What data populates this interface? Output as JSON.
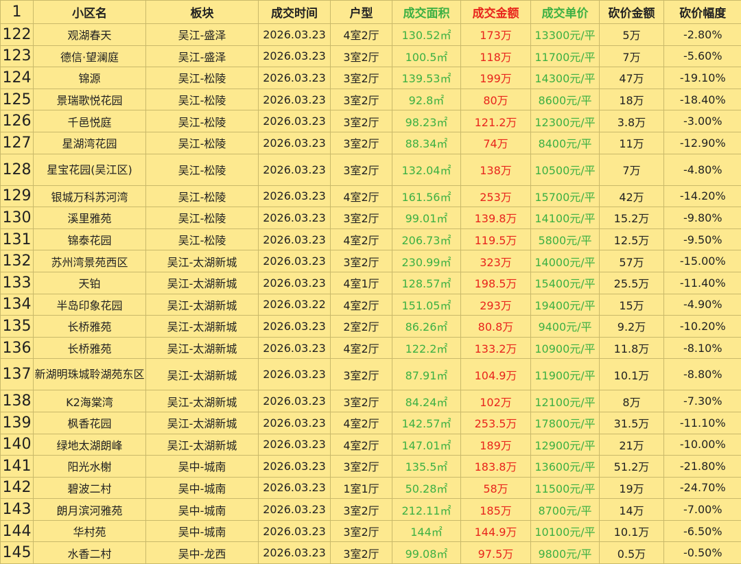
{
  "headers": [
    {
      "text": "1",
      "color": ""
    },
    {
      "text": "小区名",
      "color": ""
    },
    {
      "text": "板块",
      "color": ""
    },
    {
      "text": "成交时间",
      "color": ""
    },
    {
      "text": "户型",
      "color": ""
    },
    {
      "text": "成交面积",
      "color": "green"
    },
    {
      "text": "成交金额",
      "color": "red"
    },
    {
      "text": "成交单价",
      "color": "green"
    },
    {
      "text": "砍价金额",
      "color": ""
    },
    {
      "text": "砍价幅度",
      "color": ""
    }
  ],
  "rows": [
    [
      "122",
      "观湖春天",
      "吴江-盛泽",
      "2026.03.23",
      "4室2厅",
      "130.52㎡",
      "173万",
      "13300元/平",
      "5万",
      "-2.80%"
    ],
    [
      "123",
      "德信·望澜庭",
      "吴江-盛泽",
      "2026.03.23",
      "3室2厅",
      "100.5㎡",
      "118万",
      "11700元/平",
      "7万",
      "-5.60%"
    ],
    [
      "124",
      "锦源",
      "吴江-松陵",
      "2026.03.23",
      "3室2厅",
      "139.53㎡",
      "199万",
      "14300元/平",
      "47万",
      "-19.10%"
    ],
    [
      "125",
      "景瑞歌悦花园",
      "吴江-松陵",
      "2026.03.23",
      "3室2厅",
      "92.8㎡",
      "80万",
      "8600元/平",
      "18万",
      "-18.40%"
    ],
    [
      "126",
      "千邑悦庭",
      "吴江-松陵",
      "2026.03.23",
      "3室2厅",
      "98.23㎡",
      "121.2万",
      "12300元/平",
      "3.8万",
      "-3.00%"
    ],
    [
      "127",
      "星湖湾花园",
      "吴江-松陵",
      "2026.03.23",
      "3室2厅",
      "88.34㎡",
      "74万",
      "8400元/平",
      "11万",
      "-12.90%"
    ],
    [
      "128",
      "星宝花园(吴江区)",
      "吴江-松陵",
      "2026.03.23",
      "3室2厅",
      "132.04㎡",
      "138万",
      "10500元/平",
      "7万",
      "-4.80%"
    ],
    [
      "129",
      "银城万科苏河湾",
      "吴江-松陵",
      "2026.03.23",
      "4室2厅",
      "161.56㎡",
      "253万",
      "15700元/平",
      "42万",
      "-14.20%"
    ],
    [
      "130",
      "溪里雅苑",
      "吴江-松陵",
      "2026.03.23",
      "3室2厅",
      "99.01㎡",
      "139.8万",
      "14100元/平",
      "15.2万",
      "-9.80%"
    ],
    [
      "131",
      "锦泰花园",
      "吴江-松陵",
      "2026.03.23",
      "4室2厅",
      "206.73㎡",
      "119.5万",
      "5800元/平",
      "12.5万",
      "-9.50%"
    ],
    [
      "132",
      "苏州湾景苑西区",
      "吴江-太湖新城",
      "2026.03.23",
      "3室2厅",
      "230.99㎡",
      "323万",
      "14000元/平",
      "57万",
      "-15.00%"
    ],
    [
      "133",
      "天铂",
      "吴江-太湖新城",
      "2026.03.23",
      "4室1厅",
      "128.57㎡",
      "198.5万",
      "15400元/平",
      "25.5万",
      "-11.40%"
    ],
    [
      "134",
      "半岛印象花园",
      "吴江-太湖新城",
      "2026.03.22",
      "4室2厅",
      "151.05㎡",
      "293万",
      "19400元/平",
      "15万",
      "-4.90%"
    ],
    [
      "135",
      "长桥雅苑",
      "吴江-太湖新城",
      "2026.03.23",
      "2室2厅",
      "86.26㎡",
      "80.8万",
      "9400元/平",
      "9.2万",
      "-10.20%"
    ],
    [
      "136",
      "长桥雅苑",
      "吴江-太湖新城",
      "2026.03.23",
      "4室2厅",
      "122.2㎡",
      "133.2万",
      "10900元/平",
      "11.8万",
      "-8.10%"
    ],
    [
      "137",
      "新湖明珠城聆湖苑东区",
      "吴江-太湖新城",
      "2026.03.23",
      "3室2厅",
      "87.91㎡",
      "104.9万",
      "11900元/平",
      "10.1万",
      "-8.80%"
    ],
    [
      "138",
      "K2海棠湾",
      "吴江-太湖新城",
      "2026.03.23",
      "3室2厅",
      "84.24㎡",
      "102万",
      "12100元/平",
      "8万",
      "-7.30%"
    ],
    [
      "139",
      "枫香花园",
      "吴江-太湖新城",
      "2026.03.23",
      "4室2厅",
      "142.57㎡",
      "253.5万",
      "17800元/平",
      "31.5万",
      "-11.10%"
    ],
    [
      "140",
      "绿地太湖朗峰",
      "吴江-太湖新城",
      "2026.03.23",
      "4室2厅",
      "147.01㎡",
      "189万",
      "12900元/平",
      "21万",
      "-10.00%"
    ],
    [
      "141",
      "阳光水榭",
      "吴中-城南",
      "2026.03.23",
      "3室2厅",
      "135.5㎡",
      "183.8万",
      "13600元/平",
      "51.2万",
      "-21.80%"
    ],
    [
      "142",
      "碧波二村",
      "吴中-城南",
      "2026.03.23",
      "1室1厅",
      "50.28㎡",
      "58万",
      "11500元/平",
      "19万",
      "-24.70%"
    ],
    [
      "143",
      "朗月滨河雅苑",
      "吴中-城南",
      "2026.03.23",
      "3室2厅",
      "212.11㎡",
      "185万",
      "8700元/平",
      "14万",
      "-7.00%"
    ],
    [
      "144",
      "华村苑",
      "吴中-城南",
      "2026.03.23",
      "3室2厅",
      "144㎡",
      "144.9万",
      "10100元/平",
      "10.1万",
      "-6.50%"
    ],
    [
      "145",
      "水香二村",
      "吴中-龙西",
      "2026.03.23",
      "3室2厅",
      "99.08㎡",
      "97.5万",
      "9800元/平",
      "0.5万",
      "-0.50%"
    ]
  ]
}
